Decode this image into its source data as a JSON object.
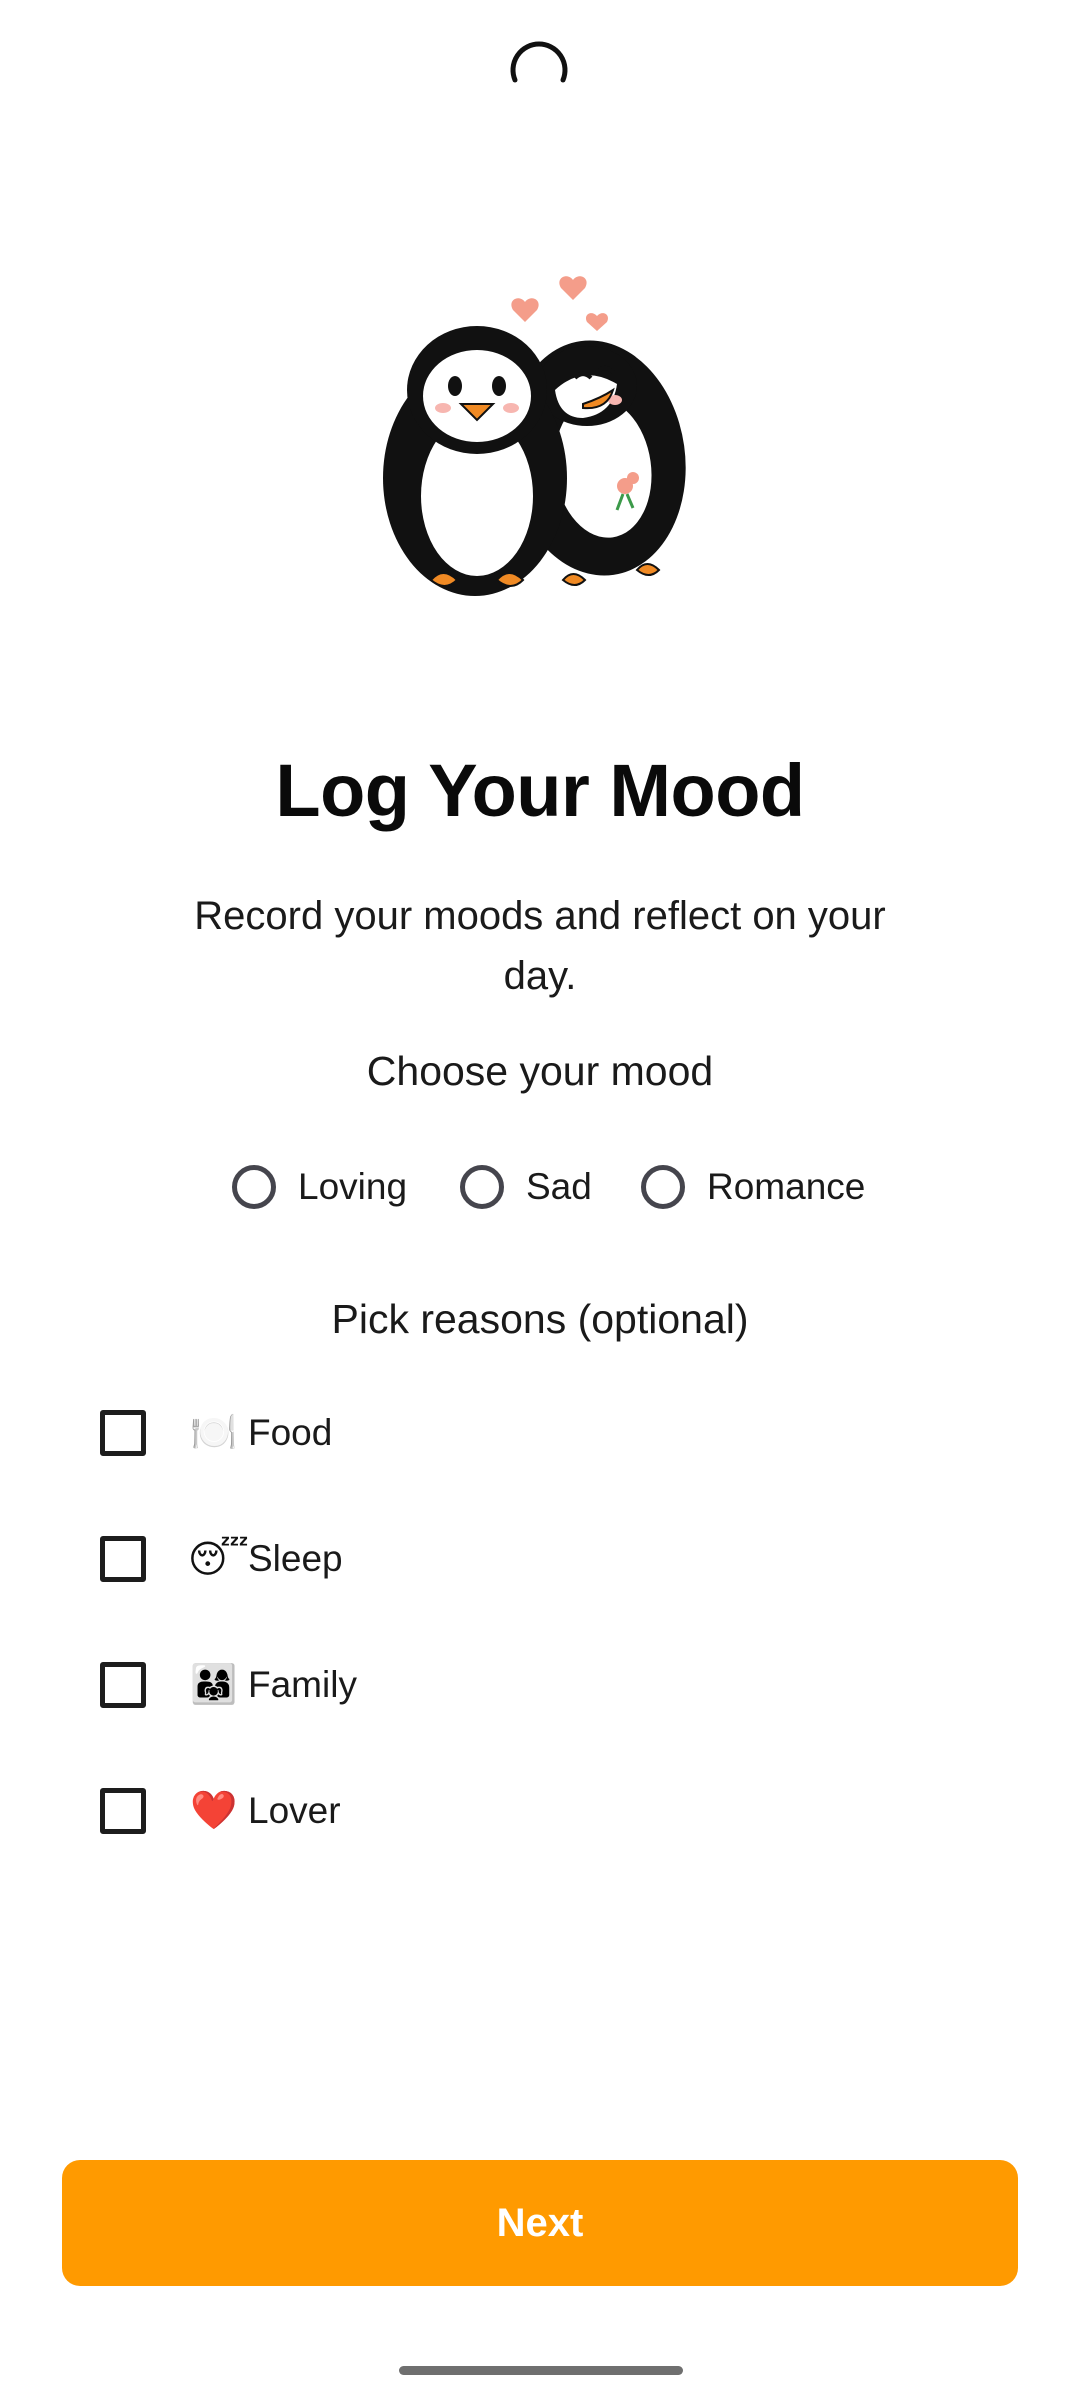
{
  "header": {
    "title": "Log Your Mood",
    "subtitle": "Record your moods and reflect on your day."
  },
  "mood": {
    "label": "Choose your mood",
    "options": [
      "Loving",
      "Sad",
      "Romance"
    ],
    "selected": null
  },
  "reasons": {
    "label": "Pick reasons (optional)",
    "items": [
      {
        "emoji": "🍽️",
        "label": "Food",
        "checked": false
      },
      {
        "emoji": "😴",
        "label": "Sleep",
        "checked": false
      },
      {
        "emoji": "👨‍👩‍👧",
        "label": "Family",
        "checked": false
      },
      {
        "emoji": "❤️",
        "label": "Lover",
        "checked": false
      }
    ]
  },
  "actions": {
    "next_label": "Next"
  },
  "icons": {
    "loading": "loading-spinner-icon",
    "hero": "penguin-couple-illustration"
  },
  "colors": {
    "accent": "#ff9a00",
    "radio_border": "#45454d",
    "checkbox_border": "#1d1d1d",
    "text": "#111111"
  }
}
